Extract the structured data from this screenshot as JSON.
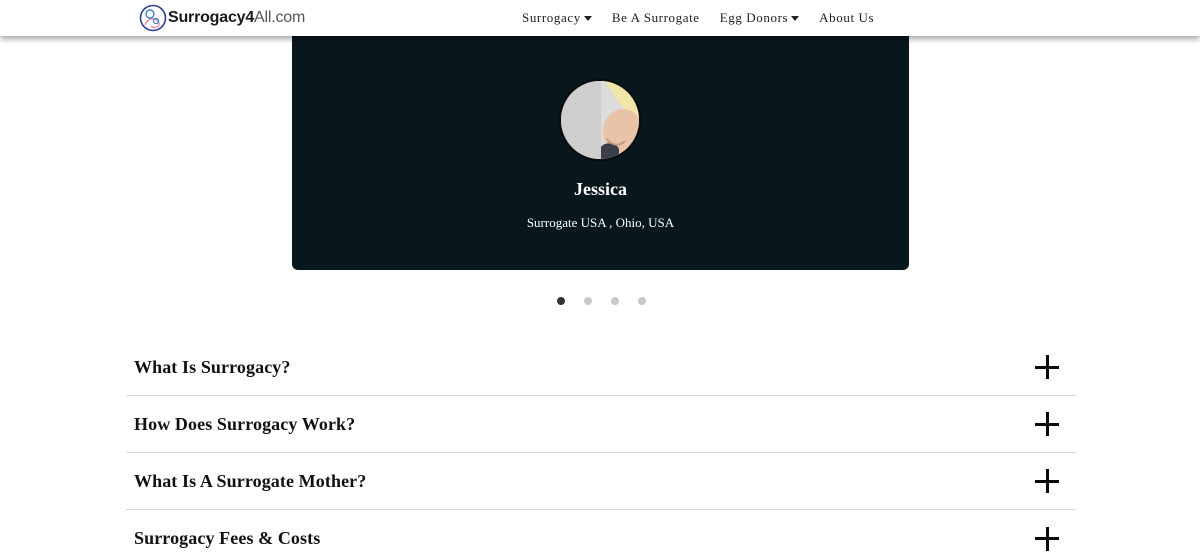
{
  "header": {
    "logo": {
      "bold": "Surrogacy4",
      "light": "All.com"
    },
    "nav": [
      {
        "label": "Surrogacy",
        "dropdown": true
      },
      {
        "label": "Be A Surrogate",
        "dropdown": false
      },
      {
        "label": "Egg Donors",
        "dropdown": true
      },
      {
        "label": "About Us",
        "dropdown": false
      }
    ]
  },
  "testimonial": {
    "name": "Jessica",
    "subtitle": "Surrogate USA , Ohio, USA",
    "background_color": "#08171c"
  },
  "carousel": {
    "slide_count": 4,
    "active_index": 0
  },
  "faq": [
    {
      "question": "What Is Surrogacy?"
    },
    {
      "question": "How Does Surrogacy Work?"
    },
    {
      "question": "What Is A Surrogate Mother?"
    },
    {
      "question": "Surrogacy Fees & Costs"
    }
  ]
}
